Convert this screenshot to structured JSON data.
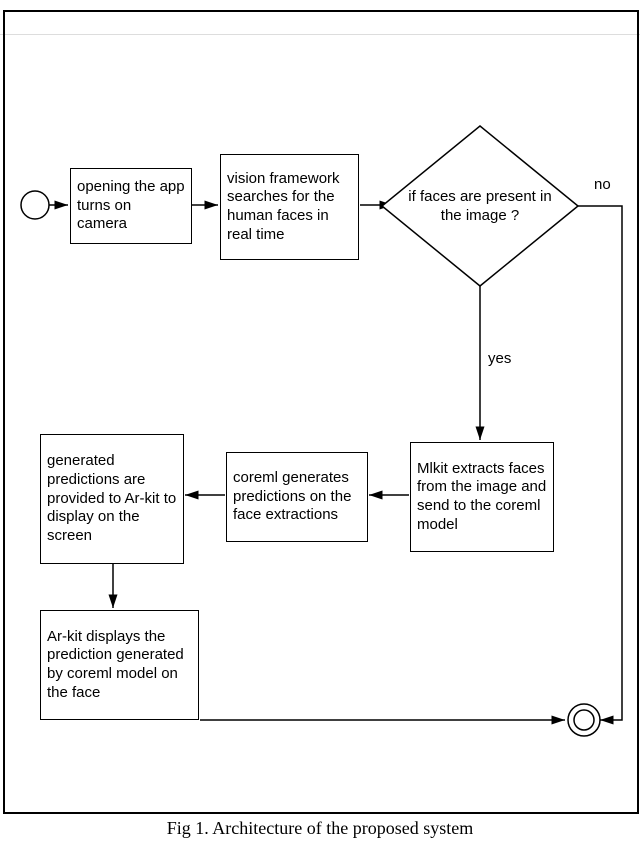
{
  "caption": "Fig 1. Architecture of the proposed system",
  "nodes": {
    "start_camera": "opening the app turns on camera",
    "vision_search": "vision framework searches for the human faces in real time",
    "decision": "if faces are present in the image ?",
    "mlkit_extract": "Mlkit extracts faces from the image and send to the coreml model",
    "coreml_predict": "coreml generates predictions on the face extractions",
    "provide_arkit": "generated predictions are provided to Ar-kit to display on the screen",
    "arkit_display": "Ar-kit displays the prediction generated by coreml model on the face"
  },
  "edges": {
    "yes_label": "yes",
    "no_label": "no"
  },
  "chart_data": {
    "type": "flowchart",
    "nodes": [
      {
        "id": "start",
        "type": "start",
        "label": ""
      },
      {
        "id": "n1",
        "type": "process",
        "label": "opening the app turns on camera"
      },
      {
        "id": "n2",
        "type": "process",
        "label": "vision framework searches for the human faces in real time"
      },
      {
        "id": "d1",
        "type": "decision",
        "label": "if faces are present in the image ?"
      },
      {
        "id": "n3",
        "type": "process",
        "label": "Mlkit extracts faces from the image and send to the coreml model"
      },
      {
        "id": "n4",
        "type": "process",
        "label": "coreml generates predictions on the face extractions"
      },
      {
        "id": "n5",
        "type": "process",
        "label": "generated predictions are provided to Ar-kit to display on the screen"
      },
      {
        "id": "n6",
        "type": "process",
        "label": "Ar-kit displays the prediction generated by coreml model on the face"
      },
      {
        "id": "end",
        "type": "end",
        "label": ""
      }
    ],
    "edges": [
      {
        "from": "start",
        "to": "n1"
      },
      {
        "from": "n1",
        "to": "n2"
      },
      {
        "from": "n2",
        "to": "d1"
      },
      {
        "from": "d1",
        "to": "n3",
        "label": "yes"
      },
      {
        "from": "d1",
        "to": "end",
        "label": "no"
      },
      {
        "from": "n3",
        "to": "n4"
      },
      {
        "from": "n4",
        "to": "n5"
      },
      {
        "from": "n5",
        "to": "n6"
      },
      {
        "from": "n6",
        "to": "end"
      }
    ]
  }
}
